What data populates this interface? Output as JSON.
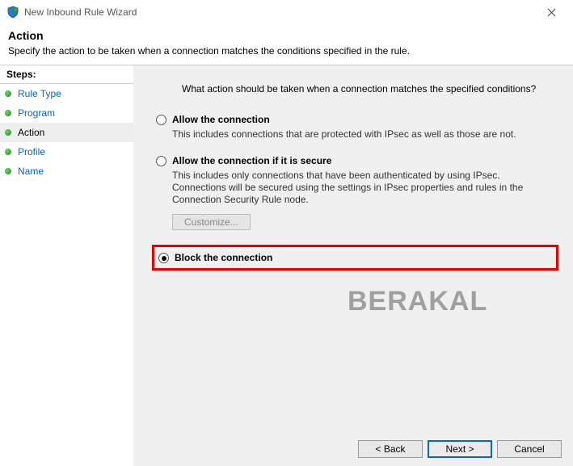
{
  "window": {
    "title": "New Inbound Rule Wizard"
  },
  "header": {
    "title": "Action",
    "subtitle": "Specify the action to be taken when a connection matches the conditions specified in the rule."
  },
  "steps": {
    "title": "Steps:",
    "items": [
      {
        "label": "Rule Type",
        "current": false
      },
      {
        "label": "Program",
        "current": false
      },
      {
        "label": "Action",
        "current": true
      },
      {
        "label": "Profile",
        "current": false
      },
      {
        "label": "Name",
        "current": false
      }
    ]
  },
  "content": {
    "question": "What action should be taken when a connection matches the specified conditions?",
    "options": {
      "allow": {
        "label": "Allow the connection",
        "desc": "This includes connections that are protected with IPsec as well as those are not."
      },
      "allow_secure": {
        "label": "Allow the connection if it is secure",
        "desc": "This includes only connections that have been authenticated by using IPsec.  Connections will be secured using the settings in IPsec properties and rules in the Connection Security Rule node.",
        "customize_label": "Customize..."
      },
      "block": {
        "label": "Block the connection"
      }
    }
  },
  "buttons": {
    "back": "< Back",
    "next": "Next >",
    "cancel": "Cancel"
  },
  "watermark": "BERAKAL"
}
